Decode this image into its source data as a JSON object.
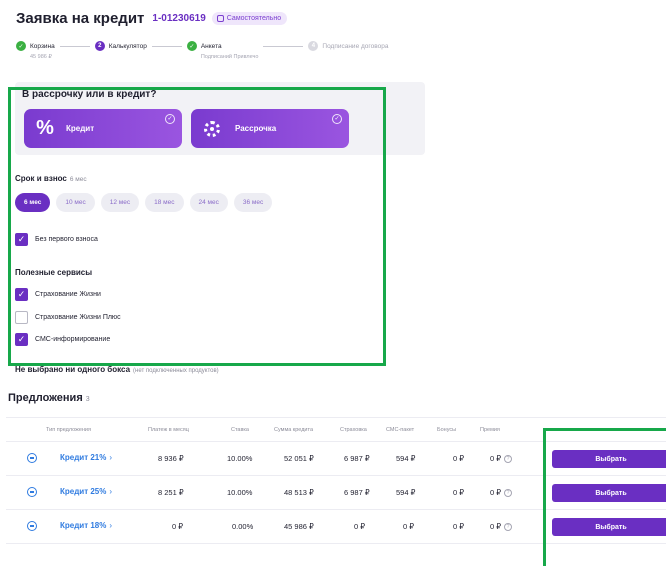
{
  "header": {
    "title": "Заявка на кредит",
    "order_number": "1-01230619",
    "badge": "Самостоятельно"
  },
  "steps": [
    {
      "label": "Корзина",
      "sub": "45 986 ₽",
      "state": "done",
      "num": "1"
    },
    {
      "label": "Калькулятор",
      "sub": "",
      "state": "active",
      "num": "2"
    },
    {
      "label": "Анкета",
      "sub": "Подписаний Привлечо",
      "state": "done",
      "num": "3"
    },
    {
      "label": "Подписание договора",
      "sub": "",
      "state": "todo",
      "num": "4"
    }
  ],
  "choice": {
    "title": "В рассрочку или в кредит?",
    "credit_label": "Кредит",
    "credit_symbol": "%",
    "installment_label": "Рассрочка",
    "check_glyph": "✓"
  },
  "term": {
    "label": "Срок и взнос",
    "selected": "6 мес",
    "options": [
      "6 мес",
      "10 мес",
      "12 мес",
      "18 мес",
      "24 мес",
      "36 мес"
    ]
  },
  "no_down_payment": {
    "label": "Без первого взноса",
    "checked": true
  },
  "services": {
    "title": "Полезные сервисы",
    "items": [
      {
        "label": "Страхование Жизни",
        "checked": true
      },
      {
        "label": "Страхование Жизни Плюс",
        "checked": false
      },
      {
        "label": "СМС-информирование",
        "checked": true
      }
    ]
  },
  "no_box": {
    "text": "Не выбрано ни одного бокса",
    "note": "(нет подключенных продуктов)"
  },
  "offers": {
    "title": "Предложения",
    "count": "3",
    "columns": [
      "Тип предложения",
      "Платеж в месяц",
      "Ставка",
      "Сумма кредита",
      "Страховка",
      "СМС-пакет",
      "Бонусы",
      "Премия"
    ],
    "help_glyph": "?",
    "select_label": "Выбрать",
    "rows": [
      {
        "name": "Кредит 21%",
        "payment": "8 936 ₽",
        "rate": "10.00%",
        "amount": "52 051 ₽",
        "insurance": "6 987 ₽",
        "sms": "594 ₽",
        "bonus": "0 ₽",
        "premium": "0 ₽"
      },
      {
        "name": "Кредит 25%",
        "payment": "8 251 ₽",
        "rate": "10.00%",
        "amount": "48 513 ₽",
        "insurance": "6 987 ₽",
        "sms": "594 ₽",
        "bonus": "0 ₽",
        "premium": "0 ₽"
      },
      {
        "name": "Кредит 18%",
        "payment": "0 ₽",
        "rate": "0.00%",
        "amount": "45 986 ₽",
        "insurance": "0 ₽",
        "sms": "0 ₽",
        "bonus": "0 ₽",
        "premium": "0 ₽"
      }
    ]
  },
  "colors": {
    "accent": "#6a2fc2",
    "link": "#2f7be0",
    "success": "#3bb042",
    "highlight": "#17a84a"
  }
}
